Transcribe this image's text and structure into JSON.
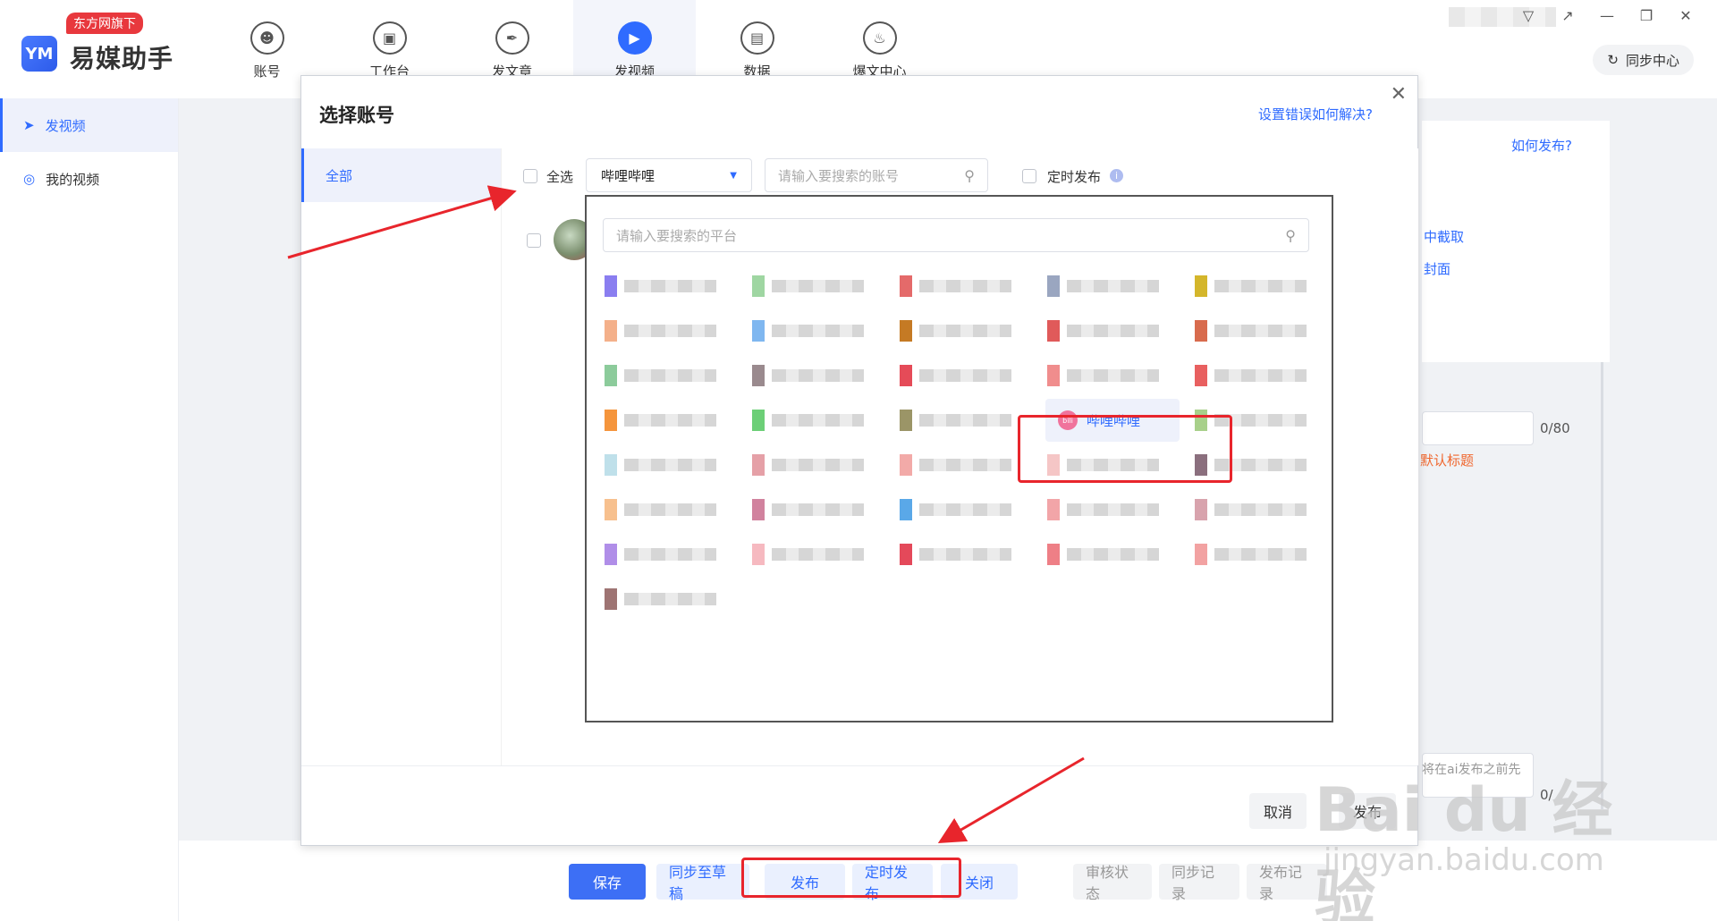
{
  "app": {
    "logo_text": "易媒助手",
    "logo_mark": "YM",
    "badge": "东方网旗下"
  },
  "nav": [
    {
      "label": "账号",
      "icon": "user-icon"
    },
    {
      "label": "工作台",
      "icon": "monitor-icon"
    },
    {
      "label": "发文章",
      "icon": "feather-icon"
    },
    {
      "label": "发视频",
      "icon": "play-icon",
      "active": true
    },
    {
      "label": "数据",
      "icon": "chart-icon"
    },
    {
      "label": "爆文中心",
      "icon": "flame-icon"
    }
  ],
  "header": {
    "sync_label": "同步中心"
  },
  "sidebar": {
    "items": [
      {
        "label": "发视频",
        "active": true
      },
      {
        "label": "我的视频"
      }
    ]
  },
  "background": {
    "how_to_publish": "如何发布?",
    "capture_from_video": "中截取",
    "cover": "封面",
    "counter": "0/80",
    "default_title": "默认标题",
    "hint_partial": "将在ai发布之前先",
    "counter2": "0/"
  },
  "bottom_actions": {
    "save": "保存",
    "sync_draft": "同步至草稿",
    "publish": "发布",
    "schedule": "定时发布",
    "close": "关闭",
    "review_status": "审核状态",
    "sync_record": "同步记录",
    "publish_record": "发布记录"
  },
  "modal": {
    "title": "选择账号",
    "help_link": "设置错误如何解决?",
    "left_tab": "全部",
    "select_all": "全选",
    "platform_selected": "哔哩哔哩",
    "account_search_placeholder": "请输入要搜索的账号",
    "scheduled_label": "定时发布",
    "cancel": "取消",
    "publish": "发布"
  },
  "dropdown": {
    "search_placeholder": "请输入要搜索的平台",
    "selected_platform": "哔哩哔哩",
    "selected_icon_text": "bili",
    "platforms": [
      {
        "color": "#8a7ef0"
      },
      {
        "color": "#9fd6a2"
      },
      {
        "color": "#e46a6a"
      },
      {
        "color": "#9aa6c0"
      },
      {
        "color": "#d4b62b"
      },
      {
        "color": "#f4b08a"
      },
      {
        "color": "#7fb7f0"
      },
      {
        "color": "#c57a24"
      },
      {
        "color": "#e05a5a"
      },
      {
        "color": "#d86b4d"
      },
      {
        "color": "#8ccb9b"
      },
      {
        "color": "#9a8a8e"
      },
      {
        "color": "#e54b58"
      },
      {
        "color": "#f08d8d"
      },
      {
        "color": "#e86060"
      },
      {
        "color": "#f5953c"
      },
      {
        "color": "#6ccf77"
      },
      {
        "color": "#9b9567"
      },
      {
        "selected": true
      },
      {
        "color": "#a8d08a"
      },
      {
        "color": "#bfe0ea"
      },
      {
        "color": "#e5a0a7"
      },
      {
        "color": "#f2aaa8"
      },
      {
        "color": "#f5c6c6"
      },
      {
        "color": "#8b6f7e"
      },
      {
        "color": "#f7c08e"
      },
      {
        "color": "#d1829e"
      },
      {
        "color": "#5aa8e8"
      },
      {
        "color": "#f2a5a8"
      },
      {
        "color": "#d8a3ad"
      },
      {
        "color": "#b08ee8"
      },
      {
        "color": "#f6b9c0"
      },
      {
        "color": "#e4495a"
      },
      {
        "color": "#ee7f86"
      },
      {
        "color": "#f2a2a2"
      },
      {
        "color": "#9e7473"
      }
    ]
  },
  "watermark": {
    "main": "Bai du 经验",
    "sub": "jingyan.baidu.com"
  },
  "colors": {
    "accent": "#2f6bff",
    "annotation_red": "#e8252c"
  }
}
